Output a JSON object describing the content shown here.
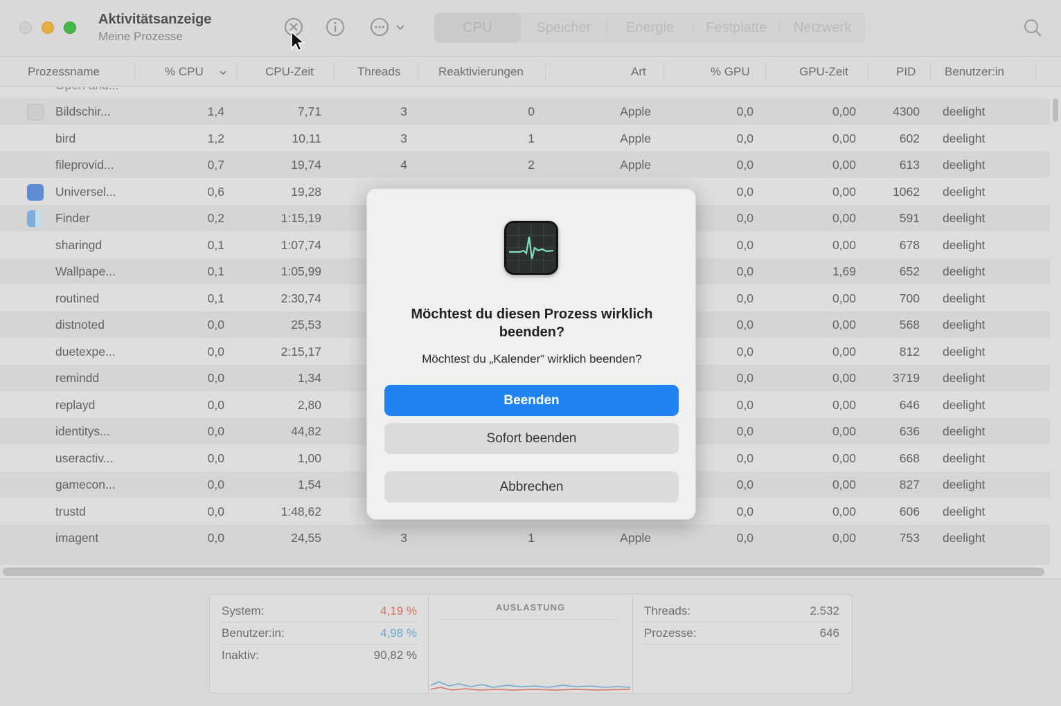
{
  "window": {
    "title": "Aktivitätsanzeige",
    "subtitle": "Meine Prozesse"
  },
  "toolbar": {
    "icons": [
      "stop-process-icon",
      "info-icon",
      "more-options-icon",
      "chevron-down-icon",
      "search-icon"
    ],
    "tabs": [
      "CPU",
      "Speicher",
      "Energie",
      "Festplatte",
      "Netzwerk"
    ],
    "active_tab": "CPU"
  },
  "columns": [
    "Prozessname",
    "% CPU",
    "CPU-Zeit",
    "Threads",
    "Reaktivierungen",
    "Art",
    "% GPU",
    "GPU-Zeit",
    "PID",
    "Benutzer:in"
  ],
  "rows": [
    {
      "name": "Bildschir...",
      "cpu": "1,4",
      "time": "7,71",
      "threads": "3",
      "wakes": "0",
      "kind": "Apple",
      "gpu": "0,0",
      "gputime": "0,00",
      "pid": "4300",
      "user": "deelight",
      "icon": "screenshot-app-icon"
    },
    {
      "name": "bird",
      "cpu": "1,2",
      "time": "10,11",
      "threads": "3",
      "wakes": "1",
      "kind": "Apple",
      "gpu": "0,0",
      "gputime": "0,00",
      "pid": "602",
      "user": "deelight"
    },
    {
      "name": "fileprovid...",
      "cpu": "0,7",
      "time": "19,74",
      "threads": "4",
      "wakes": "2",
      "kind": "Apple",
      "gpu": "0,0",
      "gputime": "0,00",
      "pid": "613",
      "user": "deelight"
    },
    {
      "name": "Universel...",
      "cpu": "0,6",
      "time": "19,28",
      "threads": "",
      "wakes": "",
      "kind": "",
      "gpu": "0,0",
      "gputime": "0,00",
      "pid": "1062",
      "user": "deelight",
      "icon": "universal-control-icon"
    },
    {
      "name": "Finder",
      "cpu": "0,2",
      "time": "1:15,19",
      "threads": "",
      "wakes": "",
      "kind": "",
      "gpu": "0,0",
      "gputime": "0,00",
      "pid": "591",
      "user": "deelight",
      "icon": "finder-icon"
    },
    {
      "name": "sharingd",
      "cpu": "0,1",
      "time": "1:07,74",
      "threads": "",
      "wakes": "",
      "kind": "",
      "gpu": "0,0",
      "gputime": "0,00",
      "pid": "678",
      "user": "deelight"
    },
    {
      "name": "Wallpape...",
      "cpu": "0,1",
      "time": "1:05,99",
      "threads": "",
      "wakes": "",
      "kind": "",
      "gpu": "0,0",
      "gputime": "1,69",
      "pid": "652",
      "user": "deelight"
    },
    {
      "name": "routined",
      "cpu": "0,1",
      "time": "2:30,74",
      "threads": "",
      "wakes": "",
      "kind": "",
      "gpu": "0,0",
      "gputime": "0,00",
      "pid": "700",
      "user": "deelight"
    },
    {
      "name": "distnoted",
      "cpu": "0,0",
      "time": "25,53",
      "threads": "",
      "wakes": "",
      "kind": "",
      "gpu": "0,0",
      "gputime": "0,00",
      "pid": "568",
      "user": "deelight"
    },
    {
      "name": "duetexpe...",
      "cpu": "0,0",
      "time": "2:15,17",
      "threads": "",
      "wakes": "",
      "kind": "",
      "gpu": "0,0",
      "gputime": "0,00",
      "pid": "812",
      "user": "deelight"
    },
    {
      "name": "remindd",
      "cpu": "0,0",
      "time": "1,34",
      "threads": "",
      "wakes": "",
      "kind": "",
      "gpu": "0,0",
      "gputime": "0,00",
      "pid": "3719",
      "user": "deelight"
    },
    {
      "name": "replayd",
      "cpu": "0,0",
      "time": "2,80",
      "threads": "",
      "wakes": "",
      "kind": "",
      "gpu": "0,0",
      "gputime": "0,00",
      "pid": "646",
      "user": "deelight"
    },
    {
      "name": "identitys...",
      "cpu": "0,0",
      "time": "44,82",
      "threads": "",
      "wakes": "",
      "kind": "",
      "gpu": "0,0",
      "gputime": "0,00",
      "pid": "636",
      "user": "deelight"
    },
    {
      "name": "useractiv...",
      "cpu": "0,0",
      "time": "1,00",
      "threads": "",
      "wakes": "",
      "kind": "",
      "gpu": "0,0",
      "gputime": "0,00",
      "pid": "668",
      "user": "deelight"
    },
    {
      "name": "gamecon...",
      "cpu": "0,0",
      "time": "1,54",
      "threads": "",
      "wakes": "",
      "kind": "",
      "gpu": "0,0",
      "gputime": "0,00",
      "pid": "827",
      "user": "deelight"
    },
    {
      "name": "trustd",
      "cpu": "0,0",
      "time": "1:48,62",
      "threads": "",
      "wakes": "",
      "kind": "",
      "gpu": "0,0",
      "gputime": "0,00",
      "pid": "606",
      "user": "deelight"
    },
    {
      "name": "imagent",
      "cpu": "0,0",
      "time": "24,55",
      "threads": "3",
      "wakes": "1",
      "kind": "Apple",
      "gpu": "0,0",
      "gputime": "0,00",
      "pid": "753",
      "user": "deelight"
    }
  ],
  "summary": {
    "system_label": "System:",
    "system_value": "4,19 %",
    "system_color": "#e0705a",
    "user_label": "Benutzer:in:",
    "user_value": "4,98 %",
    "user_color": "#6aaed8",
    "idle_label": "Inaktiv:",
    "idle_value": "90,82 %",
    "load_title": "AUSLASTUNG",
    "threads_label": "Threads:",
    "threads_value": "2.532",
    "processes_label": "Prozesse:",
    "processes_value": "646"
  },
  "dialog": {
    "title": "Möchtest du diesen Prozess wirklich beenden?",
    "message": "Möchtest du „Kalender“ wirklich beenden?",
    "quit_label": "Beenden",
    "force_quit_label": "Sofort beenden",
    "cancel_label": "Abbrechen",
    "icon": "activity-monitor-icon",
    "accent_color": "#1f84f2"
  }
}
